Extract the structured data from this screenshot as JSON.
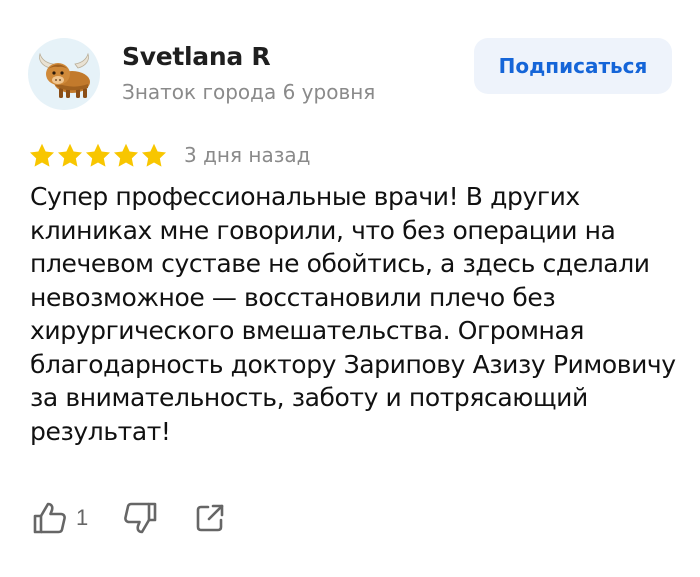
{
  "author": {
    "avatar_icon": "yak-avatar-icon",
    "name": "Svetlana R",
    "level": "Знаток города 6 уровня"
  },
  "subscribe": {
    "label": "Подписаться"
  },
  "rating": {
    "stars": 5,
    "max": 5,
    "color": "#f8c600"
  },
  "review": {
    "date": "3 дня назад",
    "text": "Супер профессиональные врачи! В других клиниках мне говорили, что без операции на плечевом суставе не обойтись, а здесь сделали невозможное — восстановили плечо без хирургического вмешательства. Огромная благодарность доктору Зарипову Азизу Римовичу за внимательность, заботу и потрясающий результат!"
  },
  "actions": {
    "like_count": "1",
    "like_icon": "thumbs-up-icon",
    "dislike_icon": "thumbs-down-icon",
    "share_icon": "share-icon"
  },
  "colors": {
    "accent": "#1565d8",
    "button_bg": "#eef3fb",
    "secondary_text": "#8a8a8a"
  }
}
